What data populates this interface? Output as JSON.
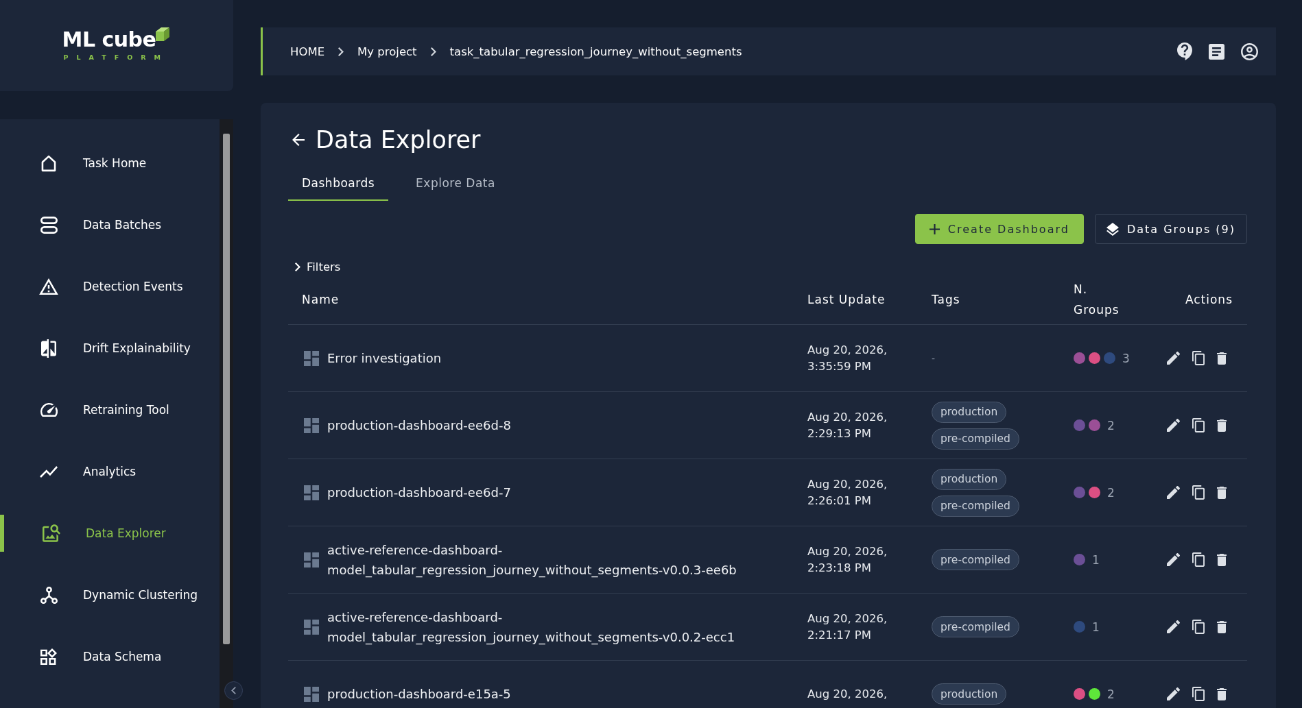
{
  "logo": {
    "name": "ML cube",
    "tagline": "PLATFORM"
  },
  "sidebar": {
    "items": [
      {
        "label": "Task Home",
        "selected": false
      },
      {
        "label": "Data Batches",
        "selected": false
      },
      {
        "label": "Detection Events",
        "selected": false
      },
      {
        "label": "Drift Explainability",
        "selected": false
      },
      {
        "label": "Retraining Tool",
        "selected": false
      },
      {
        "label": "Analytics",
        "selected": false
      },
      {
        "label": "Data Explorer",
        "selected": true
      },
      {
        "label": "Dynamic Clustering",
        "selected": false
      },
      {
        "label": "Data Schema",
        "selected": false
      }
    ]
  },
  "breadcrumb": [
    "HOME",
    "My project",
    "task_tabular_regression_journey_without_segments"
  ],
  "page_title": "Data Explorer",
  "tabs": [
    {
      "label": "Dashboards",
      "selected": true
    },
    {
      "label": "Explore Data",
      "selected": false
    }
  ],
  "toolbar_buttons": [
    {
      "label": "Create Dashboard",
      "kind": "primary"
    },
    {
      "label": "Data Groups (9)",
      "kind": "secondary"
    }
  ],
  "filters": {
    "label": "Filters",
    "expanded": false
  },
  "table": {
    "columns": [
      "Name",
      "Last Update",
      "Tags",
      "N. Groups",
      "Actions"
    ],
    "rows": [
      {
        "name": "Error investigation",
        "last_update": "Aug 20, 2026, 3:35:59 PM",
        "no_tags": "-",
        "groups": [
          {
            "color": "#9b4f96"
          },
          {
            "color": "#db4f83"
          },
          {
            "color": "#2e4a7e"
          }
        ],
        "group_count": "3"
      },
      {
        "name": "production-dashboard-ee6d-8",
        "last_update": "Aug 20, 2026, 2:29:13 PM",
        "tags": [
          "production",
          "pre-compiled"
        ],
        "groups": [
          {
            "color": "#6b4f96"
          },
          {
            "color": "#9b4f96"
          }
        ],
        "group_count": "2"
      },
      {
        "name": "production-dashboard-ee6d-7",
        "last_update": "Aug 20, 2026, 2:26:01 PM",
        "tags": [
          "production",
          "pre-compiled"
        ],
        "groups": [
          {
            "color": "#6b4f96"
          },
          {
            "color": "#db4f83"
          }
        ],
        "group_count": "2"
      },
      {
        "name": "active-reference-dashboard-model_tabular_regression_journey_without_segments-v0.0.3-ee6b",
        "last_update": "Aug 20, 2026, 2:23:18 PM",
        "tags": [
          "pre-compiled"
        ],
        "groups": [
          {
            "color": "#6b4f96"
          }
        ],
        "group_count": "1"
      },
      {
        "name": "active-reference-dashboard-model_tabular_regression_journey_without_segments-v0.0.2-ecc1",
        "last_update": "Aug 20, 2026, 2:21:17 PM",
        "tags": [
          "pre-compiled"
        ],
        "groups": [
          {
            "color": "#2e4a7e"
          }
        ],
        "group_count": "1"
      },
      {
        "name": "production-dashboard-e15a-5",
        "last_update": "Aug 20, 2026,",
        "tags": [
          "production"
        ],
        "groups": [
          {
            "color": "#db4f83"
          },
          {
            "color": "#5ee63a"
          }
        ],
        "group_count": "2"
      }
    ]
  }
}
